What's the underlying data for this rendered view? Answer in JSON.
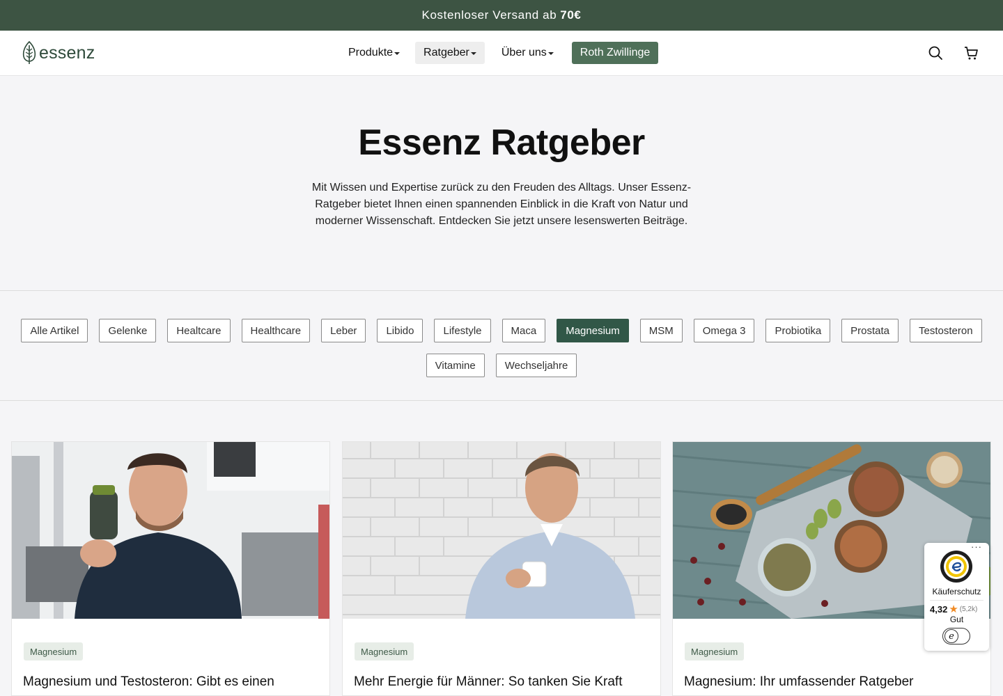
{
  "promo": {
    "text": "Kostenloser Versand ab",
    "amount": "70€"
  },
  "header": {
    "logo_text": "essenz",
    "nav": [
      {
        "label": "Produkte"
      },
      {
        "label": "Ratgeber",
        "active": true
      },
      {
        "label": "Über uns"
      }
    ],
    "cta_label": "Roth Zwillinge",
    "icons": [
      "search-icon",
      "cart-icon"
    ]
  },
  "hero": {
    "title": "Essenz Ratgeber",
    "description": "Mit Wissen und Expertise zurück zu den Freuden des Alltags. Unser Essenz-Ratgeber bietet Ihnen einen spannenden Einblick in die Kraft von Natur und moderner Wissenschaft. Entdecken Sie jetzt unsere lesenswerten Beiträge."
  },
  "filters": {
    "row1": [
      "Alle Artikel",
      "Gelenke",
      "Healtcare",
      "Healthcare",
      "Leber",
      "Libido",
      "Lifestyle",
      "Maca",
      "Magnesium",
      "MSM",
      "Omega 3",
      "Probiotika",
      "Prostata",
      "Testosteron"
    ],
    "row2": [
      "Vitamine",
      "Wechseljahre"
    ],
    "selected": "Magnesium"
  },
  "articles": [
    {
      "tag": "Magnesium",
      "title": "Magnesium und Testosteron: Gibt es einen"
    },
    {
      "tag": "Magnesium",
      "title": "Mehr Energie für Männer: So tanken Sie Kraft"
    },
    {
      "tag": "Magnesium",
      "title": "Magnesium: Ihr umfassender Ratgeber"
    }
  ],
  "trust_badge": {
    "dots": "···",
    "label": "Käuferschutz",
    "rating": "4,32",
    "count": "(5,2k)",
    "grade": "Gut",
    "toggle_glyph": "e"
  },
  "colors": {
    "brand_dark": "#3d5443",
    "cta": "#4f7059",
    "chip_selected": "#315747",
    "tag_bg": "#e7ede7",
    "star": "#f08a24"
  }
}
